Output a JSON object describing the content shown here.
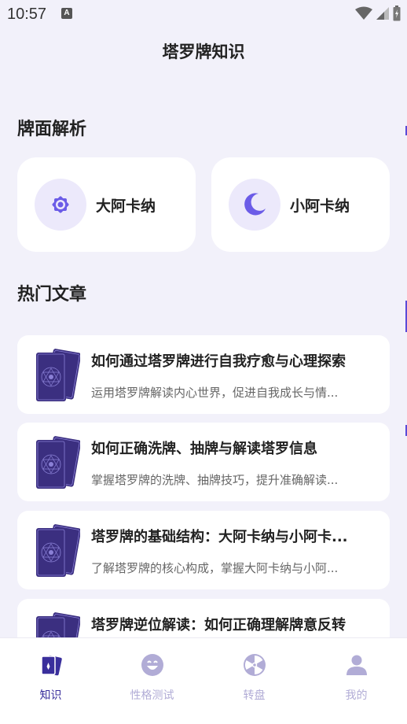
{
  "status_bar": {
    "time": "10:57",
    "notification_glyph": "A"
  },
  "header": {
    "title": "塔罗牌知识"
  },
  "section_card_types": {
    "title": "牌面解析"
  },
  "categories": [
    {
      "label": "大阿卡纳",
      "icon": "sun-icon"
    },
    {
      "label": "小阿卡纳",
      "icon": "moon-icon"
    }
  ],
  "section_articles": {
    "title": "热门文章"
  },
  "articles": [
    {
      "title": "如何通过塔罗牌进行自我疗愈与心理探索",
      "summary": "运用塔罗牌解读内心世界，促进自我成长与情..."
    },
    {
      "title": "如何正确洗牌、抽牌与解读塔罗信息",
      "summary": "掌握塔罗牌的洗牌、抽牌技巧，提升准确解读..."
    },
    {
      "title": "塔罗牌的基础结构：大阿卡纳与小阿卡...",
      "summary": "了解塔罗牌的核心构成，掌握大阿卡纳与小阿..."
    },
    {
      "title": "塔罗牌逆位解读：如何正确理解牌意反转",
      "summary": ""
    }
  ],
  "tabs": [
    {
      "label": "知识",
      "icon": "cards-icon",
      "active": true
    },
    {
      "label": "性格测试",
      "icon": "smile-icon",
      "active": false
    },
    {
      "label": "转盘",
      "icon": "wheel-icon",
      "active": false
    },
    {
      "label": "我的",
      "icon": "person-icon",
      "active": false
    }
  ],
  "colors": {
    "accent": "#6b5ce7",
    "active_tab": "#3a2f9c",
    "inactive_tab": "#b1acd6",
    "background": "#f2f1fa"
  }
}
